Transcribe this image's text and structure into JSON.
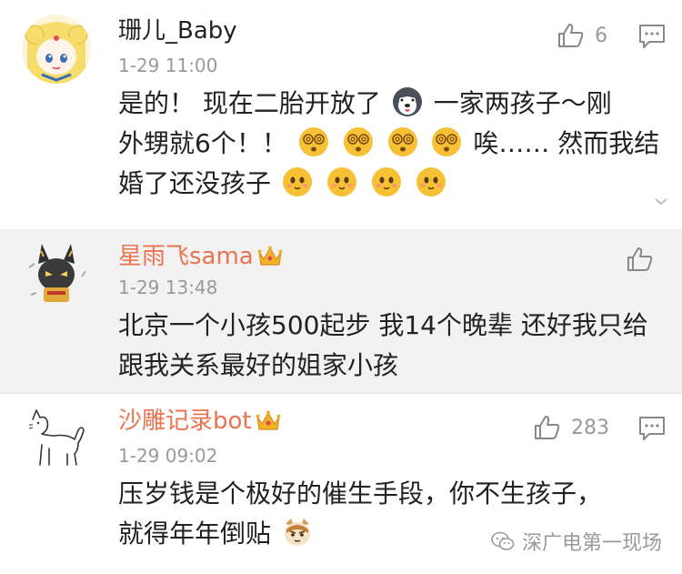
{
  "comments": [
    {
      "username": "珊儿_Baby",
      "time": "1-29 11:00",
      "likes": "6",
      "text_lines": [
        "是的！ 现在二胎开放了",
        "一家两孩子～刚",
        "外甥就6个！！",
        "唉…… 然而我结",
        "婚了还没孩子"
      ],
      "icons": [
        "sailor-moon-avatar",
        "husky-emoji",
        "dizzy-face-emoji",
        "cute-face-emoji"
      ]
    },
    {
      "username": "星雨飞sama",
      "time": "1-29 13:48",
      "likes": "",
      "text_lines": [
        "北京一个小孩500起步 我14个晚辈 还好我只给",
        "跟我关系最好的姐家小孩"
      ],
      "icons": [
        "anubis-cat-avatar",
        "crown-icon"
      ]
    },
    {
      "username": "沙雕记录bot",
      "time": "1-29 09:02",
      "likes": "283",
      "text_lines": [
        "压岁钱是个极好的催生手段，你不生孩子，",
        "就得年年倒贴"
      ],
      "icons": [
        "sketch-cat-avatar",
        "crown-icon",
        "cat-emoji"
      ]
    }
  ],
  "watermark": "深广电第一现场",
  "colors": {
    "vip_name": "#eb7350",
    "gray": "#999999",
    "text": "#222222",
    "highlight_bg": "#f2f2f2"
  }
}
